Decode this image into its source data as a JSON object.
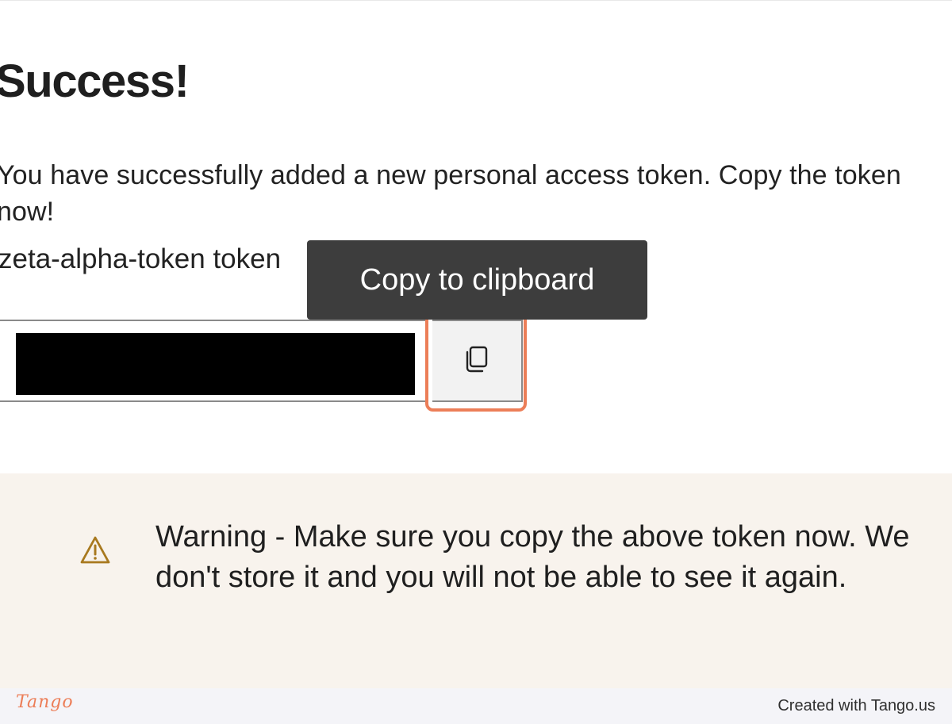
{
  "page": {
    "title": "Success!",
    "success_text": "You have successfully added a new personal access token. Copy the token now!",
    "token_name": "zeta-alpha-token token"
  },
  "token_field": {
    "value": "",
    "masked": true
  },
  "copy_button": {
    "tooltip": "Copy to clipboard",
    "icon": "copy-icon"
  },
  "warning": {
    "icon": "warning-icon",
    "text": "Warning - Make sure you copy the above token now. We don't store it and you will not be able to see it again."
  },
  "footer": {
    "brand": "Tango",
    "credit": "Created with Tango.us"
  },
  "colors": {
    "highlight": "#ec7e58",
    "warning_panel": "#f8f3ed",
    "warning_icon": "#a8791f",
    "tooltip_background": "#3d3d3d"
  }
}
